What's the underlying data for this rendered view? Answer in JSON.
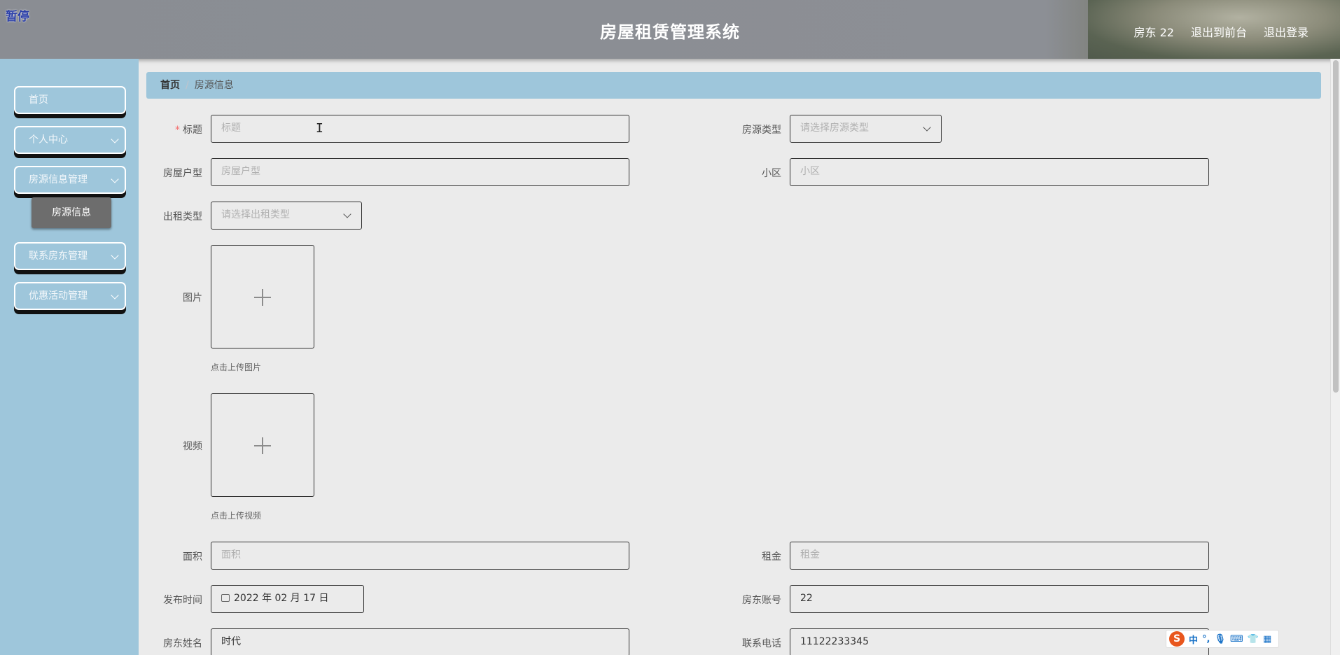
{
  "header": {
    "pause_label": "暂停",
    "title": "房屋租赁管理系统",
    "user": "房东 22",
    "to_front": "退出到前台",
    "logout": "退出登录"
  },
  "sidebar": {
    "items": [
      {
        "label": "首页"
      },
      {
        "label": "个人中心"
      },
      {
        "label": "房源信息管理"
      },
      {
        "label": "联系房东管理"
      },
      {
        "label": "优惠活动管理"
      }
    ],
    "sub_item": "房源信息"
  },
  "breadcrumb": {
    "home": "首页",
    "current": "房源信息"
  },
  "form": {
    "title": {
      "label": "标题",
      "placeholder": "标题",
      "required_mark": "*"
    },
    "house_type": {
      "label": "房源类型",
      "placeholder": "请选择房源类型"
    },
    "layout": {
      "label": "房屋户型",
      "placeholder": "房屋户型"
    },
    "community": {
      "label": "小区",
      "placeholder": "小区"
    },
    "rent_type": {
      "label": "出租类型",
      "placeholder": "请选择出租类型"
    },
    "image": {
      "label": "图片",
      "hint": "点击上传图片"
    },
    "video": {
      "label": "视频",
      "hint": "点击上传视频"
    },
    "area": {
      "label": "面积",
      "placeholder": "面积"
    },
    "rent": {
      "label": "租金",
      "placeholder": "租金"
    },
    "publish_time": {
      "label": "发布时间",
      "value": "2022 年 02 月 17 日"
    },
    "landlord_account": {
      "label": "房东账号",
      "value": "22"
    },
    "landlord_name": {
      "label": "房东姓名",
      "value": "时代"
    },
    "phone": {
      "label": "联系电话",
      "value": "11122233345"
    }
  },
  "ime": {
    "logo": "S",
    "lang": "中",
    "punct": "°,",
    "icons": [
      "mic-icon",
      "keyboard-icon",
      "shirt-icon",
      "grid-icon"
    ]
  }
}
